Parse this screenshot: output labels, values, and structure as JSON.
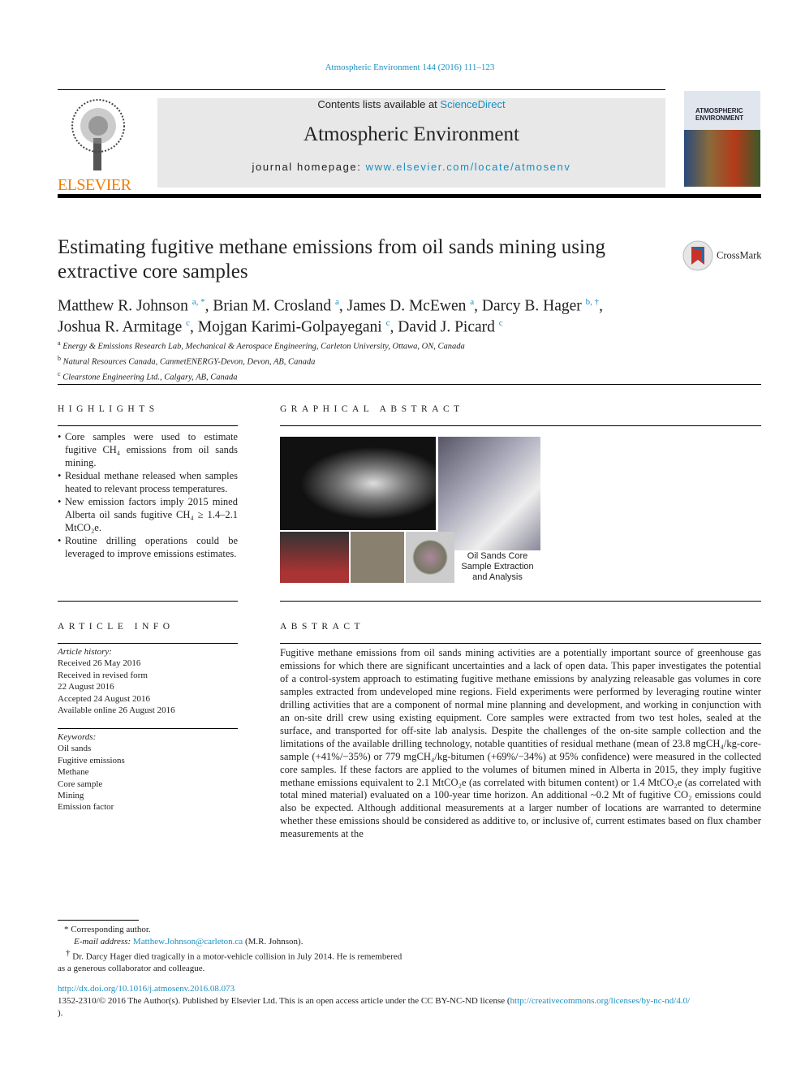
{
  "header": {
    "journal_ref": "Atmospheric Environment 144 (2016) 111–123",
    "contents_prefix": "Contents lists available at ",
    "contents_link": "ScienceDirect",
    "journal_title": "Atmospheric Environment",
    "homepage_prefix": "journal homepage: ",
    "homepage_link": "www.elsevier.com/locate/atmosenv",
    "publisher_logo": "ELSEVIER",
    "cover_text": "ATMOSPHERIC ENVIRONMENT",
    "crossmark": "CrossMark"
  },
  "article": {
    "title": "Estimating fugitive methane emissions from oil sands mining using extractive core samples",
    "authors": [
      {
        "name": "Matthew R. Johnson",
        "sup": "a, *"
      },
      {
        "name": "Brian M. Crosland",
        "sup": "a"
      },
      {
        "name": "James D. McEwen",
        "sup": "a"
      },
      {
        "name": "Darcy B. Hager",
        "sup": "b, †"
      },
      {
        "name": "Joshua R. Armitage",
        "sup": "c"
      },
      {
        "name": "Mojgan Karimi-Golpayegani",
        "sup": "c"
      },
      {
        "name": "David J. Picard",
        "sup": "c"
      }
    ],
    "affiliations": [
      {
        "sup": "a",
        "text": "Energy & Emissions Research Lab, Mechanical & Aerospace Engineering, Carleton University, Ottawa, ON, Canada"
      },
      {
        "sup": "b",
        "text": "Natural Resources Canada, CanmetENERGY-Devon, Devon, AB, Canada"
      },
      {
        "sup": "c",
        "text": "Clearstone Engineering Ltd., Calgary, AB, Canada"
      }
    ]
  },
  "highlights": {
    "heading": "HIGHLIGHTS",
    "items": [
      "Core samples were used to estimate fugitive CH₄ emissions from oil sands mining.",
      "Residual methane released when samples heated to relevant process temperatures.",
      "New emission factors imply 2015 mined Alberta oil sands fugitive CH₄ ≥ 1.4–2.1 MtCO₂e.",
      "Routine drilling operations could be leveraged to improve emissions estimates."
    ]
  },
  "graphical_abstract": {
    "heading": "GRAPHICAL ABSTRACT",
    "caption": "Oil Sands Core Sample Extraction and Analysis"
  },
  "article_info": {
    "heading": "ARTICLE INFO",
    "history_label": "Article history:",
    "history": [
      "Received 26 May 2016",
      "Received in revised form",
      "22 August 2016",
      "Accepted 24 August 2016",
      "Available online 26 August 2016"
    ],
    "keywords_label": "Keywords:",
    "keywords": [
      "Oil sands",
      "Fugitive emissions",
      "Methane",
      "Core sample",
      "Mining",
      "Emission factor"
    ]
  },
  "abstract": {
    "heading": "ABSTRACT",
    "text": "Fugitive methane emissions from oil sands mining activities are a potentially important source of greenhouse gas emissions for which there are significant uncertainties and a lack of open data. This paper investigates the potential of a control-system approach to estimating fugitive methane emissions by analyzing releasable gas volumes in core samples extracted from undeveloped mine regions. Field experiments were performed by leveraging routine winter drilling activities that are a component of normal mine planning and development, and working in conjunction with an on-site drill crew using existing equipment. Core samples were extracted from two test holes, sealed at the surface, and transported for off-site lab analysis. Despite the challenges of the on-site sample collection and the limitations of the available drilling technology, notable quantities of residual methane (mean of 23.8 mgCH₄/kg-core-sample (+41%/−35%) or 779 mgCH₄/kg-bitumen (+69%/−34%) at 95% confidence) were measured in the collected core samples. If these factors are applied to the volumes of bitumen mined in Alberta in 2015, they imply fugitive methane emissions equivalent to 2.1 MtCO₂e (as correlated with bitumen content) or 1.4 MtCO₂e (as correlated with total mined material) evaluated on a 100-year time horizon. An additional ~0.2 Mt of fugitive CO₂ emissions could also be expected. Although additional measurements at a larger number of locations are warranted to determine whether these emissions should be considered as additive to, or inclusive of, current estimates based on flux chamber measurements at the"
  },
  "footnotes": {
    "corresponding": "Corresponding author.",
    "email_label": "E-mail address: ",
    "email": "Matthew.Johnson@carleton.ca",
    "email_suffix": " (M.R. Johnson).",
    "dagger": "Dr. Darcy Hager died tragically in a motor-vehicle collision in July 2014. He is remembered as a generous collaborator and colleague."
  },
  "doi": {
    "link": "http://dx.doi.org/10.1016/j.atmosenv.2016.08.073",
    "license_text": "1352-2310/© 2016 The Author(s). Published by Elsevier Ltd. This is an open access article under the CC BY-NC-ND license (",
    "license_link": "http://creativecommons.org/licenses/by-nc-nd/4.0/",
    "license_end": ")."
  },
  "colors": {
    "link": "#1a8fc0",
    "elsevier": "#f07c00",
    "banner": "#e8e8e8"
  }
}
